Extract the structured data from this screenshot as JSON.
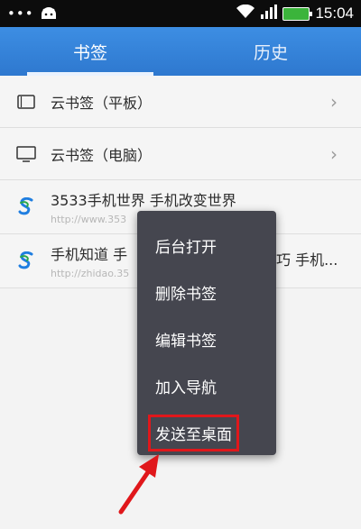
{
  "status_bar": {
    "time": "15:04",
    "battery_label": "",
    "icons": [
      "notification-dots",
      "android-icon",
      "wifi-icon",
      "signal-icon",
      "battery-icon"
    ]
  },
  "tabs": [
    {
      "label": "书签",
      "active": true
    },
    {
      "label": "历史",
      "active": false
    }
  ],
  "bookmarks": [
    {
      "title": "云书签（平板）",
      "icon": "tablet-icon",
      "has_chevron": true
    },
    {
      "title": "云书签（电脑）",
      "icon": "monitor-icon",
      "has_chevron": true
    },
    {
      "title": "3533手机世界 手机改变世界",
      "url": "http://www.353",
      "icon": "site-logo-icon"
    },
    {
      "title": "手机知道 手",
      "title_tail": "巧 手机...",
      "url": "http://zhidao.35",
      "icon": "site-logo-icon"
    }
  ],
  "context_menu": {
    "items": [
      "后台打开",
      "删除书签",
      "编辑书签",
      "加入导航",
      "发送至桌面"
    ],
    "highlighted_index": 4
  },
  "colors": {
    "tab_bar": "#2e78cf",
    "menu_bg": "#45464f",
    "highlight": "#e0171b"
  }
}
